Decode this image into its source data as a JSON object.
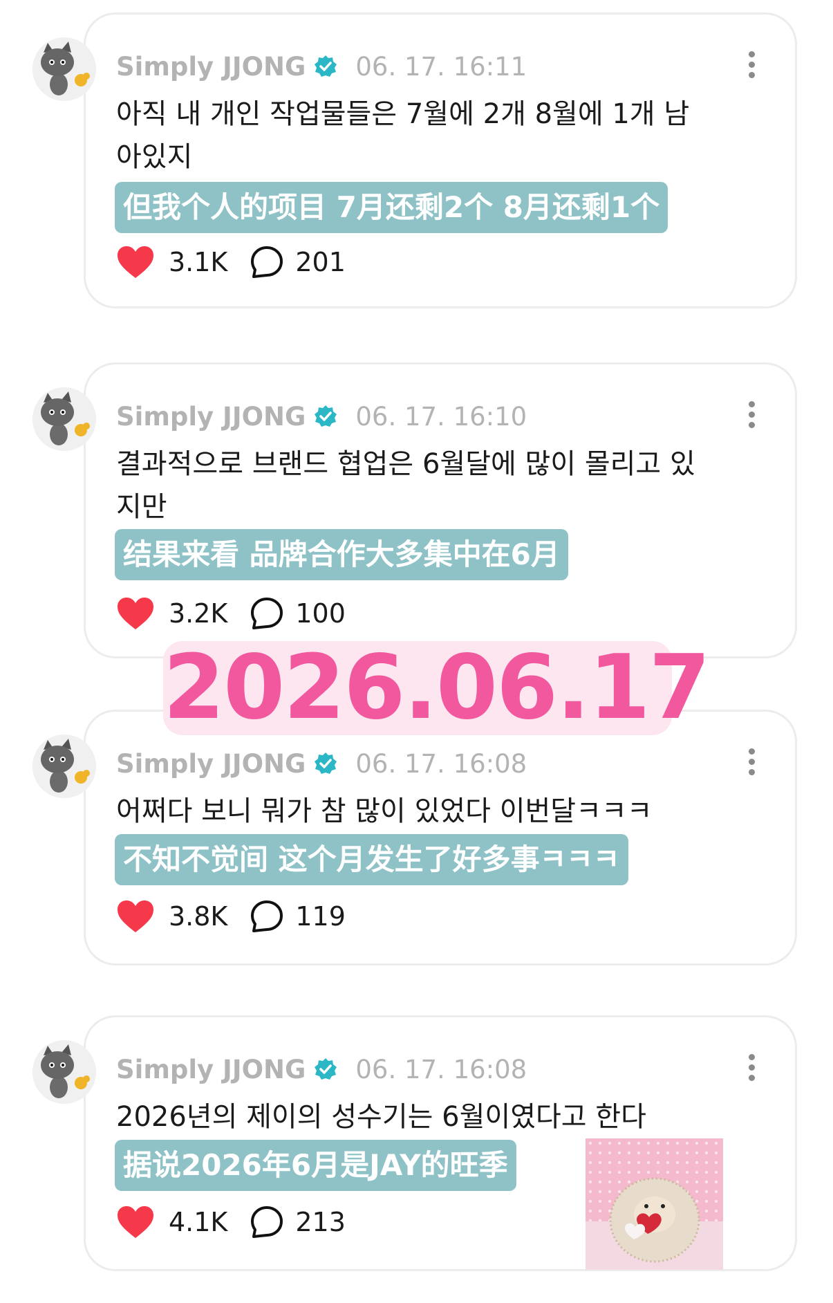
{
  "posts": [
    {
      "username": "Simply JJONG",
      "timestamp": "06. 17. 16:11",
      "text_ko": "아직 내 개인 작업물들은 7월에 2개 8월에 1개 남아있지",
      "text_zh": "但我个人的项目 7月还剩2个 8月还剩1个",
      "likes": "3.1K",
      "replies": "201"
    },
    {
      "username": "Simply JJONG",
      "timestamp": "06. 17. 16:10",
      "text_ko": "결과적으로 브랜드 협업은 6월달에 많이 몰리고 있지만",
      "text_zh": "结果来看 品牌合作大多集中在6月",
      "likes": "3.2K",
      "replies": "100"
    },
    {
      "username": "Simply JJONG",
      "timestamp": "06. 17. 16:08",
      "text_ko": "어쩌다 보니 뭐가 참 많이 있었다 이번달ㅋㅋㅋ",
      "text_zh": "不知不觉间 这个月发生了好多事ㅋㅋㅋ",
      "likes": "3.8K",
      "replies": "119"
    },
    {
      "username": "Simply JJONG",
      "timestamp": "06. 17. 16:08",
      "text_ko": "2026년의 제이의 성수기는 6월이였다고 한다",
      "text_zh": "据说2026年6月是JAY的旺季",
      "likes": "4.1K",
      "replies": "213"
    }
  ],
  "date_banner": "2026.06.17",
  "icons": {
    "avatar": "cat-avatar-icon",
    "verified": "verified-badge-icon",
    "more": "more-options-icon",
    "like": "heart-icon",
    "reply": "comment-bubble-icon",
    "photo": "hedgehog-with-heart-photo"
  },
  "colors": {
    "verified": "#2bb7c6",
    "heart": "#f5384a",
    "zh_box": "#8ec2c6",
    "banner_bg": "#fde6ef",
    "banner_text": "#f2589e"
  }
}
